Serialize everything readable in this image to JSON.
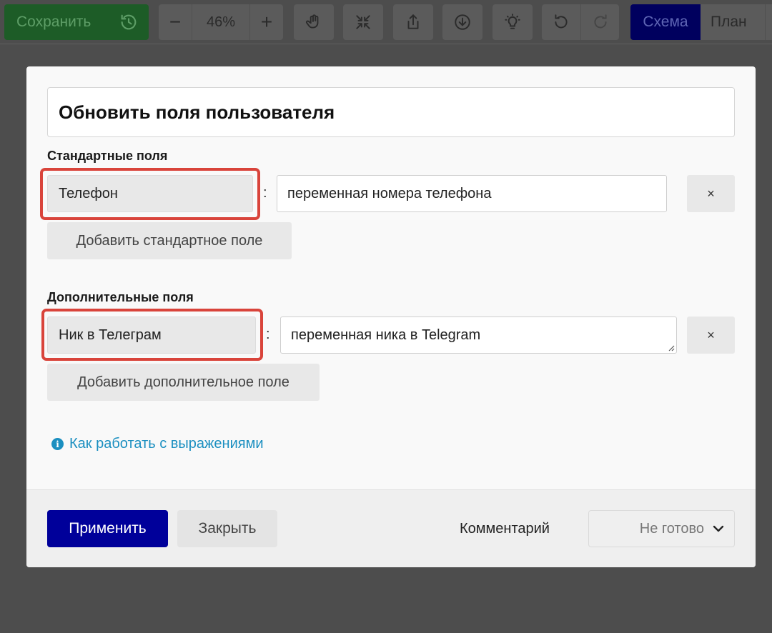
{
  "toolbar": {
    "save_label": "Сохранить",
    "zoom_minus": "−",
    "zoom_value": "46%",
    "zoom_plus": "+",
    "mode_active": "Схема",
    "mode_inactive": "План"
  },
  "modal": {
    "title": "Обновить поля пользователя",
    "standard_section_label": "Стандартные поля",
    "standard_fields": [
      {
        "key": "Телефон",
        "value": "переменная номера телефона"
      }
    ],
    "add_standard_label": "Добавить стандартное поле",
    "extra_section_label": "Дополнительные поля",
    "extra_fields": [
      {
        "key": "Ник в Телеграм",
        "value": "переменная ника в Telegram"
      }
    ],
    "add_extra_label": "Добавить дополнительное поле",
    "separator": ":",
    "remove_label": "×",
    "help_link": "Как работать с выражениями"
  },
  "footer": {
    "apply_label": "Применить",
    "close_label": "Закрыть",
    "comment_label": "Комментарий",
    "status_value": "Не готово"
  },
  "colors": {
    "accent": "#00009a",
    "save_green": "#1d5c27",
    "highlight_red": "#d9443b",
    "link_blue": "#1b8fc0"
  }
}
